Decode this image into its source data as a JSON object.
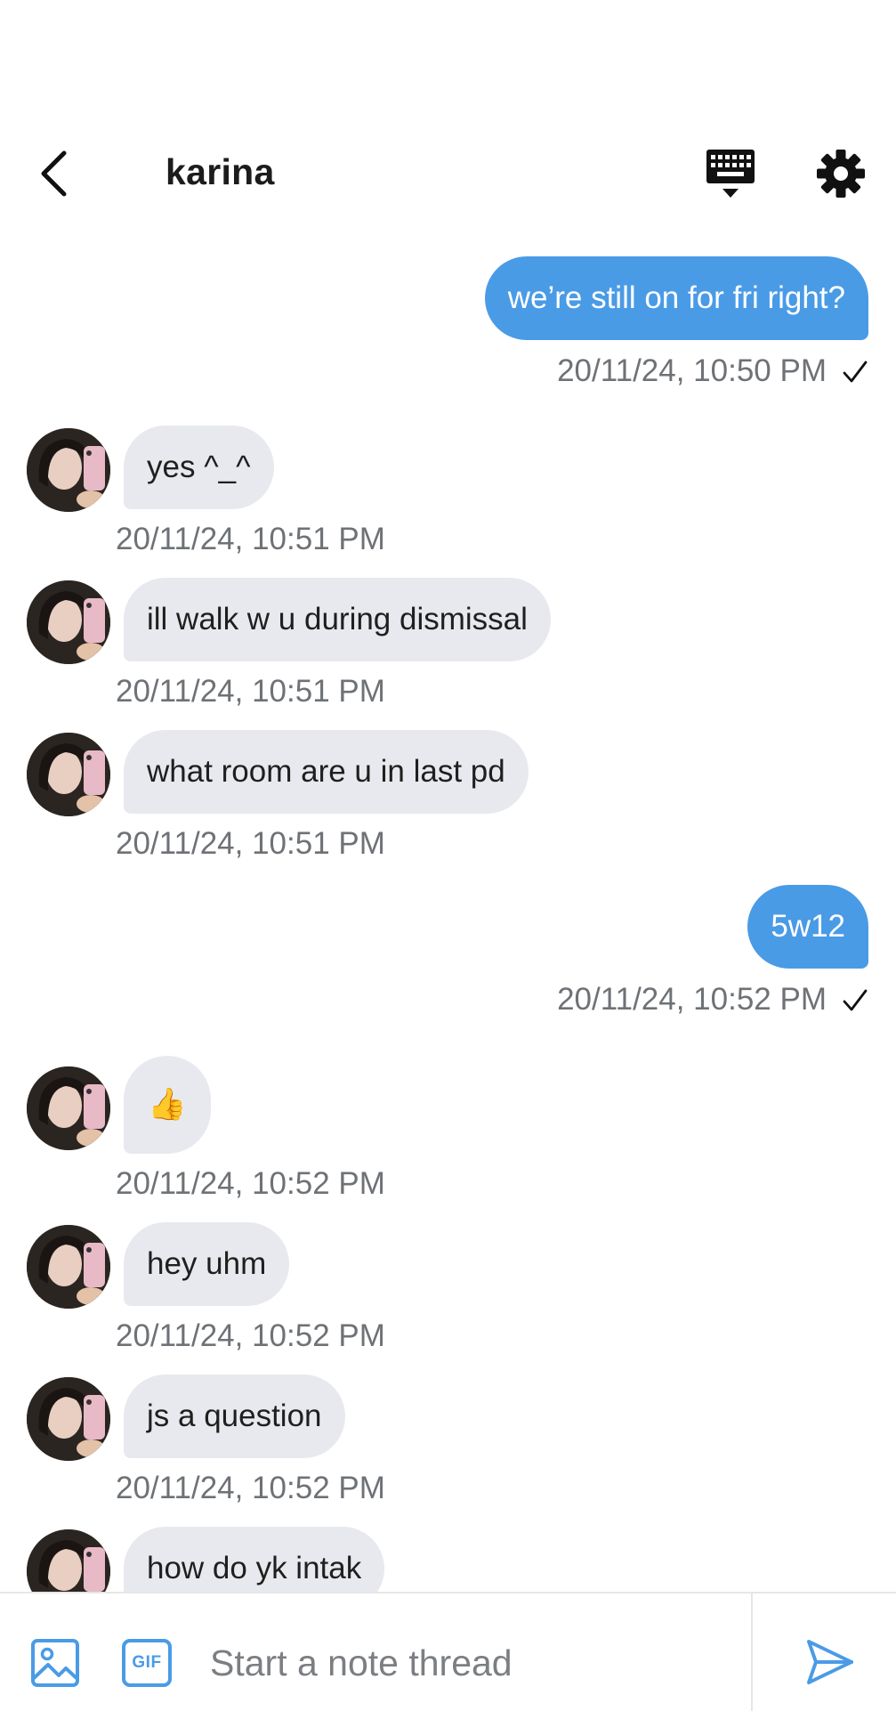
{
  "header": {
    "title": "karina",
    "icons": {
      "back": "chevron-left-icon",
      "keyboard": "keyboard-icon",
      "settings": "gear-icon"
    }
  },
  "messages": [
    {
      "direction": "out",
      "text": "we’re still on for fri right?",
      "time": "20/11/24, 10:50 PM",
      "read_mark": "checkmark-icon"
    },
    {
      "direction": "in",
      "text": "yes ^_^",
      "time": "20/11/24, 10:51 PM"
    },
    {
      "direction": "in",
      "text": "ill walk w u during dismissal",
      "time": "20/11/24, 10:51 PM"
    },
    {
      "direction": "in",
      "text": "what room are u in last pd",
      "time": "20/11/24, 10:51 PM"
    },
    {
      "direction": "out",
      "text": "5w12",
      "time": "20/11/24, 10:52 PM",
      "read_mark": "checkmark-icon"
    },
    {
      "direction": "in",
      "text": "👍",
      "time": "20/11/24, 10:52 PM"
    },
    {
      "direction": "in",
      "text": "hey uhm",
      "time": "20/11/24, 10:52 PM"
    },
    {
      "direction": "in",
      "text": "js a question",
      "time": "20/11/24, 10:52 PM"
    },
    {
      "direction": "in",
      "text": "how do yk intak",
      "time": ""
    }
  ],
  "composer": {
    "placeholder": "Start a note thread",
    "gif_label": "GIF",
    "icons": {
      "image": "image-icon",
      "gif": "gif-icon",
      "send": "send-icon"
    }
  },
  "colors": {
    "outgoing_bubble": "#4a9be6",
    "incoming_bubble": "#e8e9ee",
    "timestamp": "#6e7276"
  }
}
